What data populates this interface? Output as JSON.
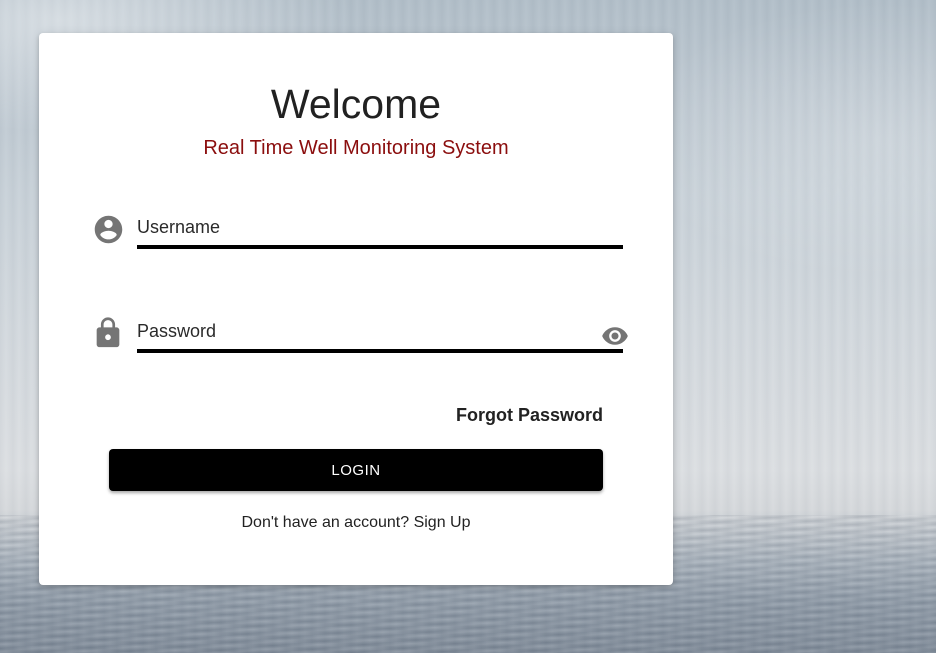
{
  "login": {
    "title": "Welcome",
    "subtitle": "Real Time Well Monitoring System",
    "username": {
      "placeholder": "Username",
      "value": "",
      "icon": "account-circle-icon"
    },
    "password": {
      "placeholder": "Password",
      "value": "",
      "icon": "lock-icon",
      "toggle_icon": "eye-icon"
    },
    "forgot_password_label": "Forgot Password",
    "login_button_label": "LOGIN",
    "signup_prompt": "Don't have an account?",
    "signup_link_label": "Sign Up"
  },
  "colors": {
    "subtitle": "#8b0e0e",
    "button_bg": "#000000",
    "button_text": "#ffffff",
    "icon": "#757575",
    "card_bg": "#ffffff"
  }
}
